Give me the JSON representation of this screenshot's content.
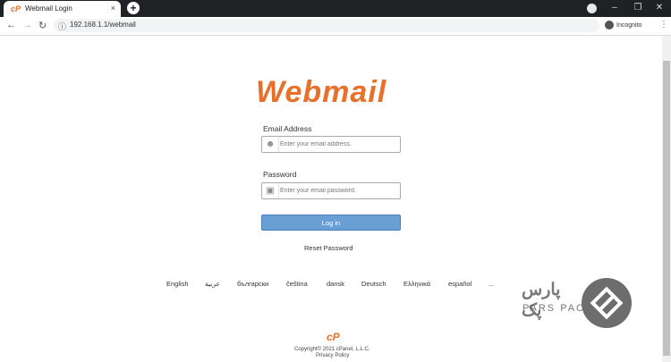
{
  "browser": {
    "tab_title": "Webmail Login",
    "tab_favicon": "cP",
    "tab_close_icon": "×",
    "new_tab_icon": "+",
    "url": "192.168.1.1/webmail",
    "incognito_label": "Incognito",
    "back_icon": "←",
    "forward_icon": "→",
    "reload_icon": "↻",
    "menu_icon": "⋮",
    "window_controls": {
      "minimize": "–",
      "maximize": "❐",
      "close": "✕"
    }
  },
  "page": {
    "logo_text": "Webmail",
    "email_label": "Email Address",
    "email_placeholder": "Enter your email address.",
    "password_label": "Password",
    "password_placeholder": "Enter your email password.",
    "login_button": "Log in",
    "reset_password": "Reset Password",
    "languages": [
      "English",
      "عربية",
      "български",
      "čeština",
      "dansk",
      "Deutsch",
      "Ελληνικά",
      "español",
      "..."
    ],
    "footer_logo": "cP",
    "copyright": "Copyright© 2021 cPanel, L.L.C.",
    "privacy_policy": "Privacy Policy"
  },
  "watermark": {
    "fa_text": "پارس پک",
    "en_text": "PARS PACK"
  },
  "colors": {
    "accent": "#e8702a",
    "button": "#6a9fd6",
    "titlebar": "#202124"
  }
}
